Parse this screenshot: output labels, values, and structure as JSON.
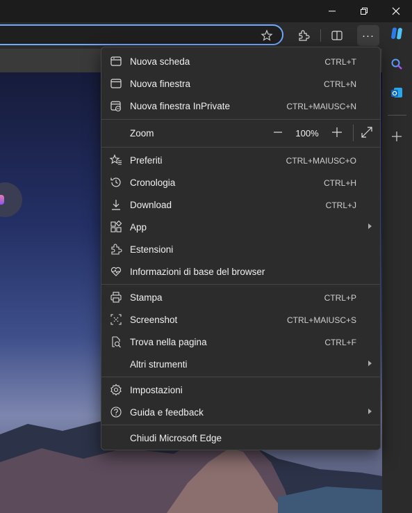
{
  "titlebar": {
    "minimize_icon": "minimize-icon",
    "restore_icon": "restore-icon",
    "close_icon": "close-icon"
  },
  "toolbar": {
    "favorite_icon": "star-icon",
    "extensions_icon": "puzzle-icon",
    "split_icon": "split-screen-icon",
    "more_label": "···"
  },
  "sidebar": {
    "icons": [
      "copilot-icon",
      "search-icon",
      "outlook-icon",
      "add-icon"
    ]
  },
  "menu": {
    "items": [
      {
        "label": "Nuova scheda",
        "shortcut": "CTRL+T",
        "icon": "new-tab-icon"
      },
      {
        "label": "Nuova finestra",
        "shortcut": "CTRL+N",
        "icon": "new-window-icon"
      },
      {
        "label": "Nuova finestra InPrivate",
        "shortcut": "CTRL+MAIUSC+N",
        "icon": "inprivate-icon"
      },
      {
        "label": "Zoom",
        "icon": ""
      },
      {
        "label": "Preferiti",
        "shortcut": "CTRL+MAIUSC+O",
        "icon": "favorites-icon"
      },
      {
        "label": "Cronologia",
        "shortcut": "CTRL+H",
        "icon": "history-icon"
      },
      {
        "label": "Download",
        "shortcut": "CTRL+J",
        "icon": "download-icon"
      },
      {
        "label": "App",
        "icon": "apps-icon"
      },
      {
        "label": "Estensioni",
        "icon": "extensions-icon"
      },
      {
        "label": "Informazioni di base del browser",
        "icon": "browser-essentials-icon"
      },
      {
        "label": "Stampa",
        "shortcut": "CTRL+P",
        "icon": "print-icon"
      },
      {
        "label": "Screenshot",
        "shortcut": "CTRL+MAIUSC+S",
        "icon": "screenshot-icon"
      },
      {
        "label": "Trova nella pagina",
        "shortcut": "CTRL+F",
        "icon": "find-icon"
      },
      {
        "label": "Altri strumenti",
        "icon": ""
      },
      {
        "label": "Impostazioni",
        "icon": "settings-icon"
      },
      {
        "label": "Guida e feedback",
        "icon": "help-icon"
      },
      {
        "label": "Chiudi Microsoft Edge",
        "icon": ""
      }
    ],
    "zoom": {
      "minus": "—",
      "value": "100%",
      "plus": "+"
    }
  },
  "colors": {
    "accent": "#6fa8ff",
    "menu_bg": "#2c2c2c",
    "toolbar_bg": "#2b2b2b"
  }
}
